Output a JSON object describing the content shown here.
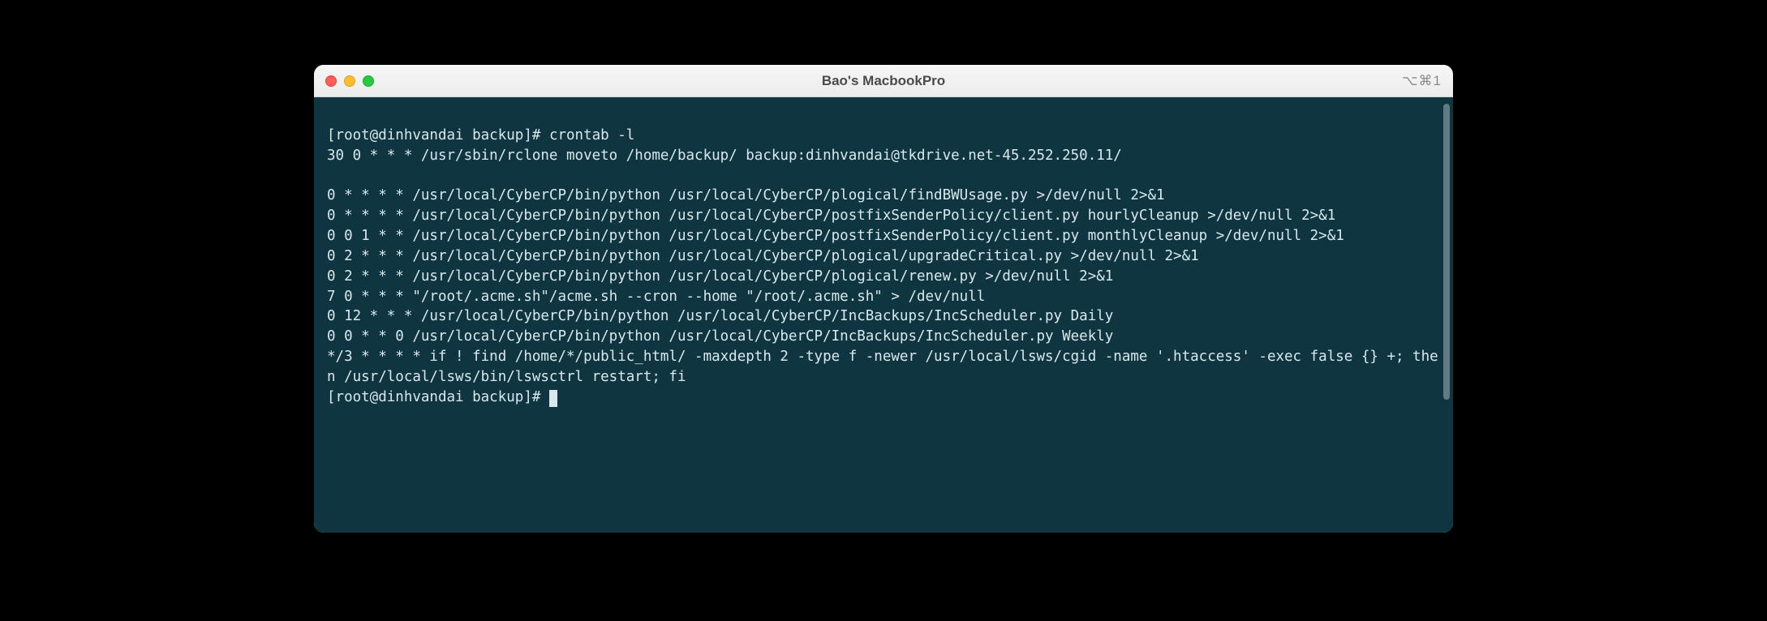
{
  "window": {
    "title": "Bao's MacbookPro",
    "shortcut": "⌥⌘1"
  },
  "prompt": {
    "text": "[root@dinhvandai backup]# "
  },
  "command": "crontab -l",
  "output_lines": [
    "30 0 * * * /usr/sbin/rclone moveto /home/backup/ backup:dinhvandai@tkdrive.net-45.252.250.11/",
    "",
    "0 * * * * /usr/local/CyberCP/bin/python /usr/local/CyberCP/plogical/findBWUsage.py >/dev/null 2>&1",
    "0 * * * * /usr/local/CyberCP/bin/python /usr/local/CyberCP/postfixSenderPolicy/client.py hourlyCleanup >/dev/null 2>&1",
    "0 0 1 * * /usr/local/CyberCP/bin/python /usr/local/CyberCP/postfixSenderPolicy/client.py monthlyCleanup >/dev/null 2>&1",
    "0 2 * * * /usr/local/CyberCP/bin/python /usr/local/CyberCP/plogical/upgradeCritical.py >/dev/null 2>&1",
    "0 2 * * * /usr/local/CyberCP/bin/python /usr/local/CyberCP/plogical/renew.py >/dev/null 2>&1",
    "7 0 * * * \"/root/.acme.sh\"/acme.sh --cron --home \"/root/.acme.sh\" > /dev/null",
    "0 12 * * * /usr/local/CyberCP/bin/python /usr/local/CyberCP/IncBackups/IncScheduler.py Daily",
    "0 0 * * 0 /usr/local/CyberCP/bin/python /usr/local/CyberCP/IncBackups/IncScheduler.py Weekly",
    "*/3 * * * * if ! find /home/*/public_html/ -maxdepth 2 -type f -newer /usr/local/lsws/cgid -name '.htaccess' -exec false {} +; then /usr/local/lsws/bin/lswsctrl restart; fi"
  ]
}
